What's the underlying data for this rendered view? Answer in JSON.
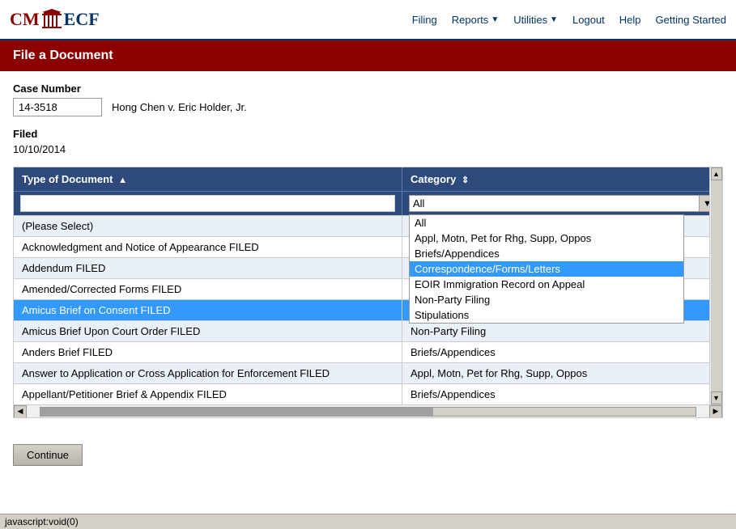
{
  "app": {
    "title": "CM/ECF",
    "logo_cm": "CM",
    "logo_ecf": "ECF"
  },
  "nav": {
    "filing": "Filing",
    "reports": "Reports",
    "utilities": "Utilities",
    "logout": "Logout",
    "help": "Help",
    "getting_started": "Getting Started"
  },
  "page": {
    "title": "File a Document"
  },
  "form": {
    "case_number_label": "Case Number",
    "case_number_value": "14-3518",
    "case_name": "Hong Chen v. Eric Holder, Jr.",
    "filed_label": "Filed",
    "filed_date": "10/10/2014"
  },
  "table": {
    "col_type_label": "Type of Document",
    "col_category_label": "Category",
    "sort_type": "▲",
    "sort_category": "⇕",
    "search_placeholder": "",
    "category_selected": "All",
    "category_options": [
      "All",
      "Appl, Motn, Pet for Rhg, Supp, Oppos",
      "Briefs/Appendices",
      "Correspondence/Forms/Letters",
      "EOIR Immigration Record on Appeal",
      "Non-Party Filing",
      "Stipulations"
    ],
    "rows": [
      {
        "type": "(Please Select)",
        "category": ""
      },
      {
        "type": "Acknowledgment and Notice of Appearance FILED",
        "category": ""
      },
      {
        "type": "Addendum FILED",
        "category": ""
      },
      {
        "type": "Amended/Corrected Forms FILED",
        "category": ""
      },
      {
        "type": "Amicus Brief on Consent FILED",
        "category": ""
      },
      {
        "type": "Amicus Brief Upon Court Order FILED",
        "category": "Non-Party Filing"
      },
      {
        "type": "Anders Brief FILED",
        "category": "Briefs/Appendices"
      },
      {
        "type": "Answer to Application or Cross Application for Enforcement FILED",
        "category": "Appl, Motn, Pet for Rhg, Supp, Oppos"
      },
      {
        "type": "Appellant/Petitioner Brief & Appendix FILED",
        "category": "Briefs/Appendices"
      }
    ],
    "visible_category_rows": [
      "",
      "",
      "",
      "",
      "",
      "Non-Party Filing",
      "Briefs/Appendices",
      "Appl, Motn, Pet for Rhg, Supp, Oppos",
      "Briefs/Appendices"
    ],
    "dropdown_highlighted": "Correspondence/Forms/Letters",
    "row_correspondence_category": "Correspondence/Forms/Letters"
  },
  "buttons": {
    "continue": "Continue"
  },
  "status_bar": {
    "text": "javascript:void(0)"
  }
}
